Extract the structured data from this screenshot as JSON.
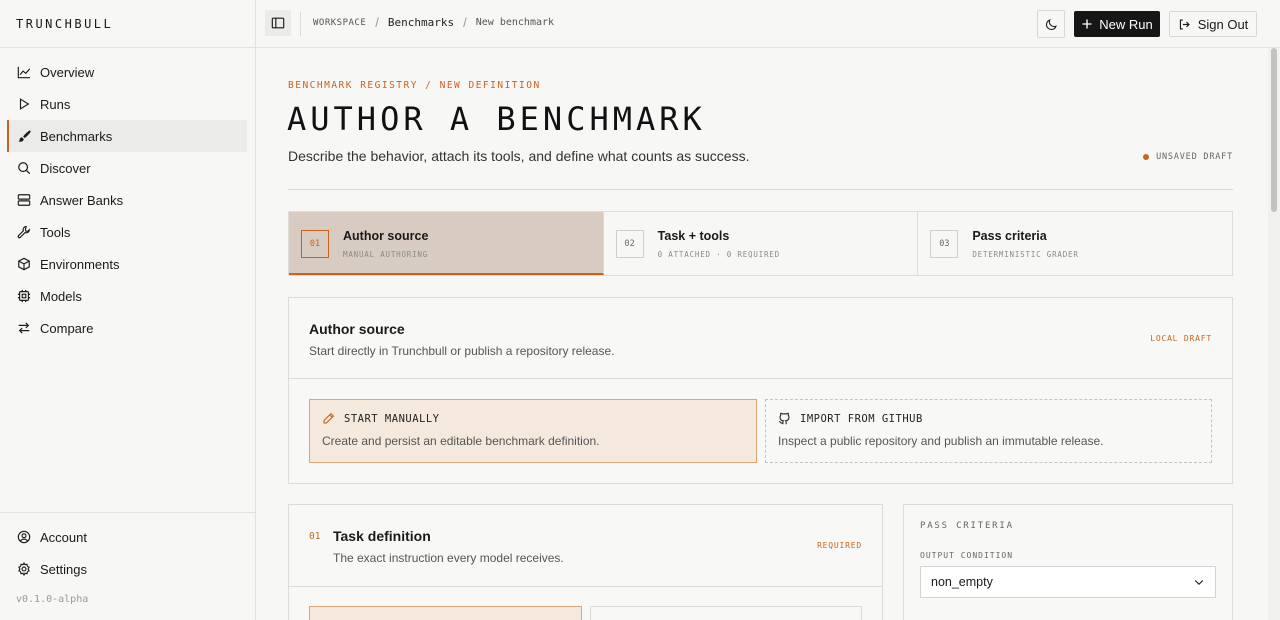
{
  "app": {
    "brand": "TRUNCHBULL",
    "version": "v0.1.0-alpha"
  },
  "sidebar": {
    "items": [
      {
        "label": "Overview",
        "icon": "chart-line-icon"
      },
      {
        "label": "Runs",
        "icon": "play-icon"
      },
      {
        "label": "Benchmarks",
        "icon": "brush-icon",
        "active": true
      },
      {
        "label": "Discover",
        "icon": "search-icon"
      },
      {
        "label": "Answer Banks",
        "icon": "database-icon"
      },
      {
        "label": "Tools",
        "icon": "wrench-icon"
      },
      {
        "label": "Environments",
        "icon": "box-icon"
      },
      {
        "label": "Models",
        "icon": "cpu-icon"
      },
      {
        "label": "Compare",
        "icon": "arrows-compare-icon"
      }
    ],
    "bottom": [
      {
        "label": "Account",
        "icon": "user-circle-icon"
      },
      {
        "label": "Settings",
        "icon": "gear-icon"
      }
    ]
  },
  "topbar": {
    "breadcrumb": [
      "WORKSPACE",
      "Benchmarks",
      "New benchmark"
    ],
    "new_run_label": "New Run",
    "sign_out_label": "Sign Out"
  },
  "page": {
    "eyebrow": "BENCHMARK REGISTRY / NEW DEFINITION",
    "title": "AUTHOR A BENCHMARK",
    "subtitle": "Describe the behavior, attach its tools, and define what counts as success.",
    "draft_status": "UNSAVED DRAFT"
  },
  "steps": [
    {
      "num": "01",
      "title": "Author source",
      "desc": "MANUAL AUTHORING",
      "active": true
    },
    {
      "num": "02",
      "title": "Task + tools",
      "desc": "0 ATTACHED · 0 REQUIRED",
      "active": false
    },
    {
      "num": "03",
      "title": "Pass criteria",
      "desc": "DETERMINISTIC GRADER",
      "active": false
    }
  ],
  "author_source": {
    "title": "Author source",
    "desc": "Start directly in Trunchbull or publish a repository release.",
    "tag": "LOCAL DRAFT",
    "options": [
      {
        "title": "START MANUALLY",
        "desc": "Create and persist an editable benchmark definition.",
        "selected": true
      },
      {
        "title": "IMPORT FROM GITHUB",
        "desc": "Inspect a public repository and publish an immutable release.",
        "selected": false
      }
    ]
  },
  "task_definition": {
    "num": "01",
    "title": "Task definition",
    "desc": "The exact instruction every model receives.",
    "tag": "REQUIRED"
  },
  "pass_criteria": {
    "title": "PASS CRITERIA",
    "output_condition_label": "OUTPUT CONDITION",
    "output_condition_value": "non_empty"
  },
  "colors": {
    "accent": "#c8641e",
    "active_step_bg": "#d8cbc1",
    "selected_option_bg": "#f5e9de"
  }
}
